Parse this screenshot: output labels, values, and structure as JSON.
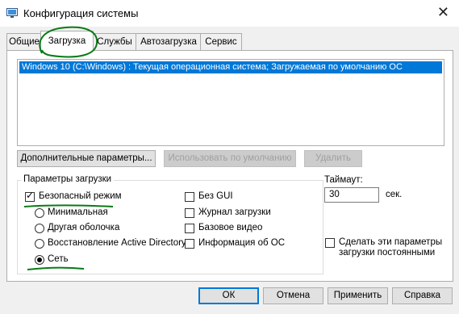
{
  "window": {
    "title": "Конфигурация системы"
  },
  "tabs": [
    {
      "label": "Общие"
    },
    {
      "label": "Загрузка"
    },
    {
      "label": "Службы"
    },
    {
      "label": "Автозагрузка"
    },
    {
      "label": "Сервис"
    }
  ],
  "boot_list": {
    "items": [
      "Windows 10 (C:\\Windows) : Текущая операционная система; Загружаемая по умолчанию ОС"
    ]
  },
  "buttons": {
    "advanced": "Дополнительные параметры...",
    "set_default": "Использовать по умолчанию",
    "delete": "Удалить",
    "ok": "ОК",
    "cancel": "Отмена",
    "apply": "Применить",
    "help": "Справка"
  },
  "boot_options": {
    "title": "Параметры загрузки",
    "safe_boot": "Безопасный режим",
    "minimal": "Минимальная",
    "alternate_shell": "Другая оболочка",
    "ad_repair": "Восстановление Active Directory",
    "network": "Сеть",
    "no_gui": "Без GUI",
    "boot_log": "Журнал загрузки",
    "base_video": "Базовое видео",
    "os_info": "Информация об ОС"
  },
  "timeout": {
    "label": "Таймаут:",
    "value": "30",
    "unit": "сек."
  },
  "make_permanent": "Сделать эти параметры загрузки постоянными",
  "colors": {
    "selection": "#0078d7",
    "annotation": "#0a7a16"
  }
}
